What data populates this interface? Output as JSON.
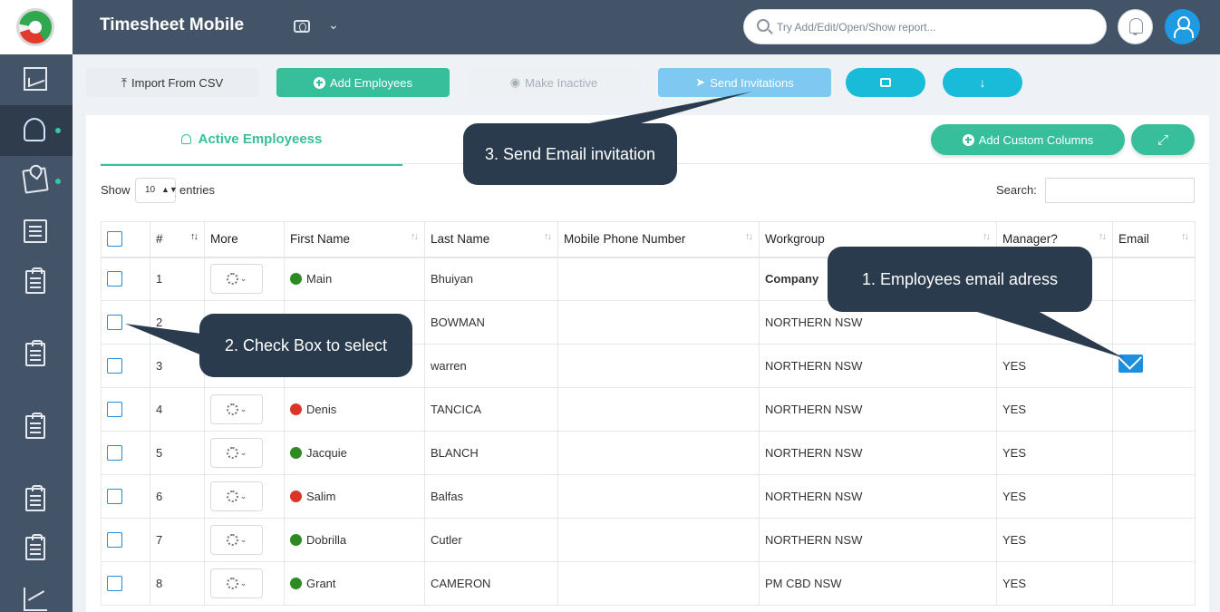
{
  "header": {
    "title": "Timesheet Mobile",
    "search_placeholder": "Try Add/Edit/Open/Show report..."
  },
  "toolbar": {
    "import_label": "Import From CSV",
    "add_label": "Add Employees",
    "inactive_label": "Make Inactive",
    "send_label": "Send Invitations"
  },
  "tabs": {
    "active_label": "Active Employeess"
  },
  "panel": {
    "custom_columns_label": "Add Custom Columns",
    "show_label": "Show",
    "page_size": "10",
    "entries_label": "entries",
    "search_label": "Search:"
  },
  "table": {
    "columns": [
      "#",
      "More",
      "First Name",
      "Last Name",
      "Mobile Phone Number",
      "Workgroup",
      "Manager?",
      "Email"
    ],
    "rows": [
      {
        "num": "1",
        "first": "Main",
        "last": "Bhuiyan",
        "phone": "",
        "workgroup": "Company",
        "manager": "",
        "status": "#2e8b23"
      },
      {
        "num": "2",
        "first": "",
        "last": "BOWMAN",
        "phone": "",
        "workgroup": "NORTHERN NSW",
        "manager": "",
        "status": ""
      },
      {
        "num": "3",
        "first": "",
        "last": "warren",
        "phone": "",
        "workgroup": "NORTHERN NSW",
        "manager": "YES",
        "status": ""
      },
      {
        "num": "4",
        "first": "Denis",
        "last": "TANCICA",
        "phone": "",
        "workgroup": "NORTHERN NSW",
        "manager": "YES",
        "status": "#d9352a"
      },
      {
        "num": "5",
        "first": "Jacquie",
        "last": "BLANCH",
        "phone": "",
        "workgroup": "NORTHERN NSW",
        "manager": "YES",
        "status": "#2e8b23"
      },
      {
        "num": "6",
        "first": "Salim",
        "last": "Balfas",
        "phone": "",
        "workgroup": "NORTHERN NSW",
        "manager": "YES",
        "status": "#d9352a"
      },
      {
        "num": "7",
        "first": "Dobrilla",
        "last": "Cutler",
        "phone": "",
        "workgroup": "NORTHERN NSW",
        "manager": "YES",
        "status": "#2e8b23"
      },
      {
        "num": "8",
        "first": "Grant",
        "last": "CAMERON",
        "phone": "",
        "workgroup": "PM CBD NSW",
        "manager": "YES",
        "status": "#2e8b23"
      }
    ]
  },
  "callouts": {
    "email": "1. Employees email adress",
    "checkbox": "2. Check Box to select",
    "invite": "3. Send Email invitation"
  },
  "colors": {
    "accent": "#37bf9c",
    "topbar": "#445468",
    "primary_blue": "#1e8fdc",
    "callout_bg": "#2b3b4e"
  }
}
